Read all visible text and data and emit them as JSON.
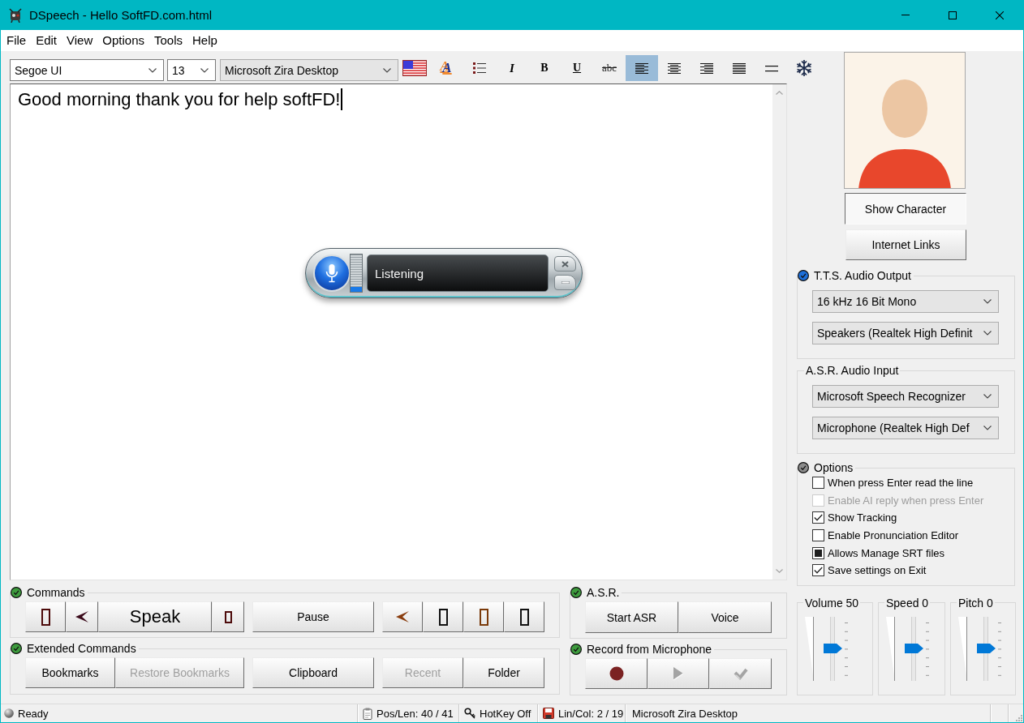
{
  "window": {
    "title": "DSpeech - Hello SoftFD.com.html"
  },
  "menu": [
    "File",
    "Edit",
    "View",
    "Options",
    "Tools",
    "Help"
  ],
  "toolbar": {
    "font": "Segoe UI",
    "size": "13",
    "voice": "Microsoft Zira Desktop",
    "tools": [
      {
        "kind": "flag",
        "selected": false
      },
      {
        "kind": "font-color",
        "label": "A",
        "selected": false
      },
      {
        "kind": "bullets",
        "selected": false
      },
      {
        "kind": "italic",
        "label": "I",
        "selected": false
      },
      {
        "kind": "bold",
        "label": "B",
        "selected": false
      },
      {
        "kind": "underline",
        "label": "U",
        "selected": false
      },
      {
        "kind": "strike",
        "label": "abc",
        "selected": false
      },
      {
        "kind": "align-left",
        "selected": true
      },
      {
        "kind": "align-center",
        "selected": false
      },
      {
        "kind": "align-right",
        "selected": false
      },
      {
        "kind": "justify",
        "selected": false
      },
      {
        "kind": "rule",
        "selected": false
      },
      {
        "kind": "snowflake",
        "selected": false
      }
    ]
  },
  "editor": {
    "text": "Good morning thank you for help softFD!"
  },
  "speech_bar": {
    "status": "Listening",
    "level": 0.12
  },
  "character": {
    "buttons": [
      {
        "label": "Show Character",
        "pressed": true
      },
      {
        "label": "Internet Links",
        "pressed": false
      }
    ]
  },
  "tts_output": {
    "title": "T.T.S. Audio Output",
    "color": "#1e6fd9",
    "selects": [
      "16 kHz 16 Bit Mono",
      "Speakers (Realtek High Definit"
    ]
  },
  "asr_input": {
    "title": "A.S.R. Audio Input",
    "selects": [
      "Microsoft Speech Recognizer",
      "Microphone (Realtek High Def"
    ]
  },
  "options": {
    "title": "Options",
    "color": "#8c8c8c",
    "items": [
      {
        "label": "When press Enter read the line",
        "checked": false,
        "mixed": false,
        "disabled": false
      },
      {
        "label": "Enable AI reply when press Enter",
        "checked": false,
        "mixed": false,
        "disabled": true
      },
      {
        "label": "Show Tracking",
        "checked": true,
        "mixed": false,
        "disabled": false
      },
      {
        "label": "Enable Pronunciation Editor",
        "checked": false,
        "mixed": false,
        "disabled": false
      },
      {
        "label": "Allows Manage SRT files",
        "checked": false,
        "mixed": true,
        "disabled": false
      },
      {
        "label": "Save settings on Exit",
        "checked": true,
        "mixed": false,
        "disabled": false
      }
    ]
  },
  "sliders": [
    {
      "label": "Volume 50",
      "level": 0.5
    },
    {
      "label": "Speed 0",
      "level": 0.5
    },
    {
      "label": "Pitch 0",
      "level": 0.5
    }
  ],
  "commands": {
    "title": "Commands",
    "color": "#3d9b3d",
    "groups": [
      [
        {
          "kind": "tall-rect",
          "color": "#4d0b0b"
        },
        {
          "kind": "arrowhead",
          "color": "#3a0a1a"
        },
        {
          "kind": "large-text",
          "label": "Speak"
        },
        {
          "kind": "small-rect",
          "color": "#4d0b0b"
        }
      ],
      [
        {
          "kind": "text",
          "label": "Pause"
        }
      ],
      [
        {
          "kind": "arrowhead",
          "color": "#8a3d0e"
        },
        {
          "kind": "tall-rect",
          "color": "#111111"
        },
        {
          "kind": "tall-rect",
          "color": "#7a3a0a"
        },
        {
          "kind": "tall-rect",
          "color": "#111111"
        }
      ]
    ]
  },
  "extended_commands": {
    "title": "Extended Commands",
    "color": "#3d9b3d",
    "groups": [
      [
        {
          "kind": "text",
          "label": "Bookmarks",
          "disabled": false
        },
        {
          "kind": "text",
          "label": "Restore Bookmarks",
          "disabled": true
        }
      ],
      [
        {
          "kind": "text",
          "label": "Clipboard",
          "disabled": false
        }
      ],
      [
        {
          "kind": "text",
          "label": "Recent",
          "disabled": true
        },
        {
          "kind": "text",
          "label": "Folder",
          "disabled": false
        }
      ]
    ]
  },
  "asr": {
    "title": "A.S.R.",
    "color": "#3d9b3d",
    "buttons": [
      {
        "label": "Start ASR"
      },
      {
        "label": "Voice"
      }
    ]
  },
  "record": {
    "title": "Record from Microphone",
    "color": "#3d9b3d",
    "buttons": [
      {
        "kind": "record",
        "disabled": false
      },
      {
        "kind": "play",
        "disabled": true
      },
      {
        "kind": "confirm",
        "disabled": true
      }
    ]
  },
  "status_bar": [
    {
      "kind": "ready",
      "text": "Ready"
    },
    {
      "kind": "clipboard",
      "text": "Pos/Len: 40 / 41"
    },
    {
      "kind": "hotkey",
      "text": "HotKey Off"
    },
    {
      "kind": "floppy",
      "text": "Lin/Col: 2 / 19"
    },
    {
      "kind": "plain",
      "text": "Microsoft Zira Desktop"
    }
  ]
}
